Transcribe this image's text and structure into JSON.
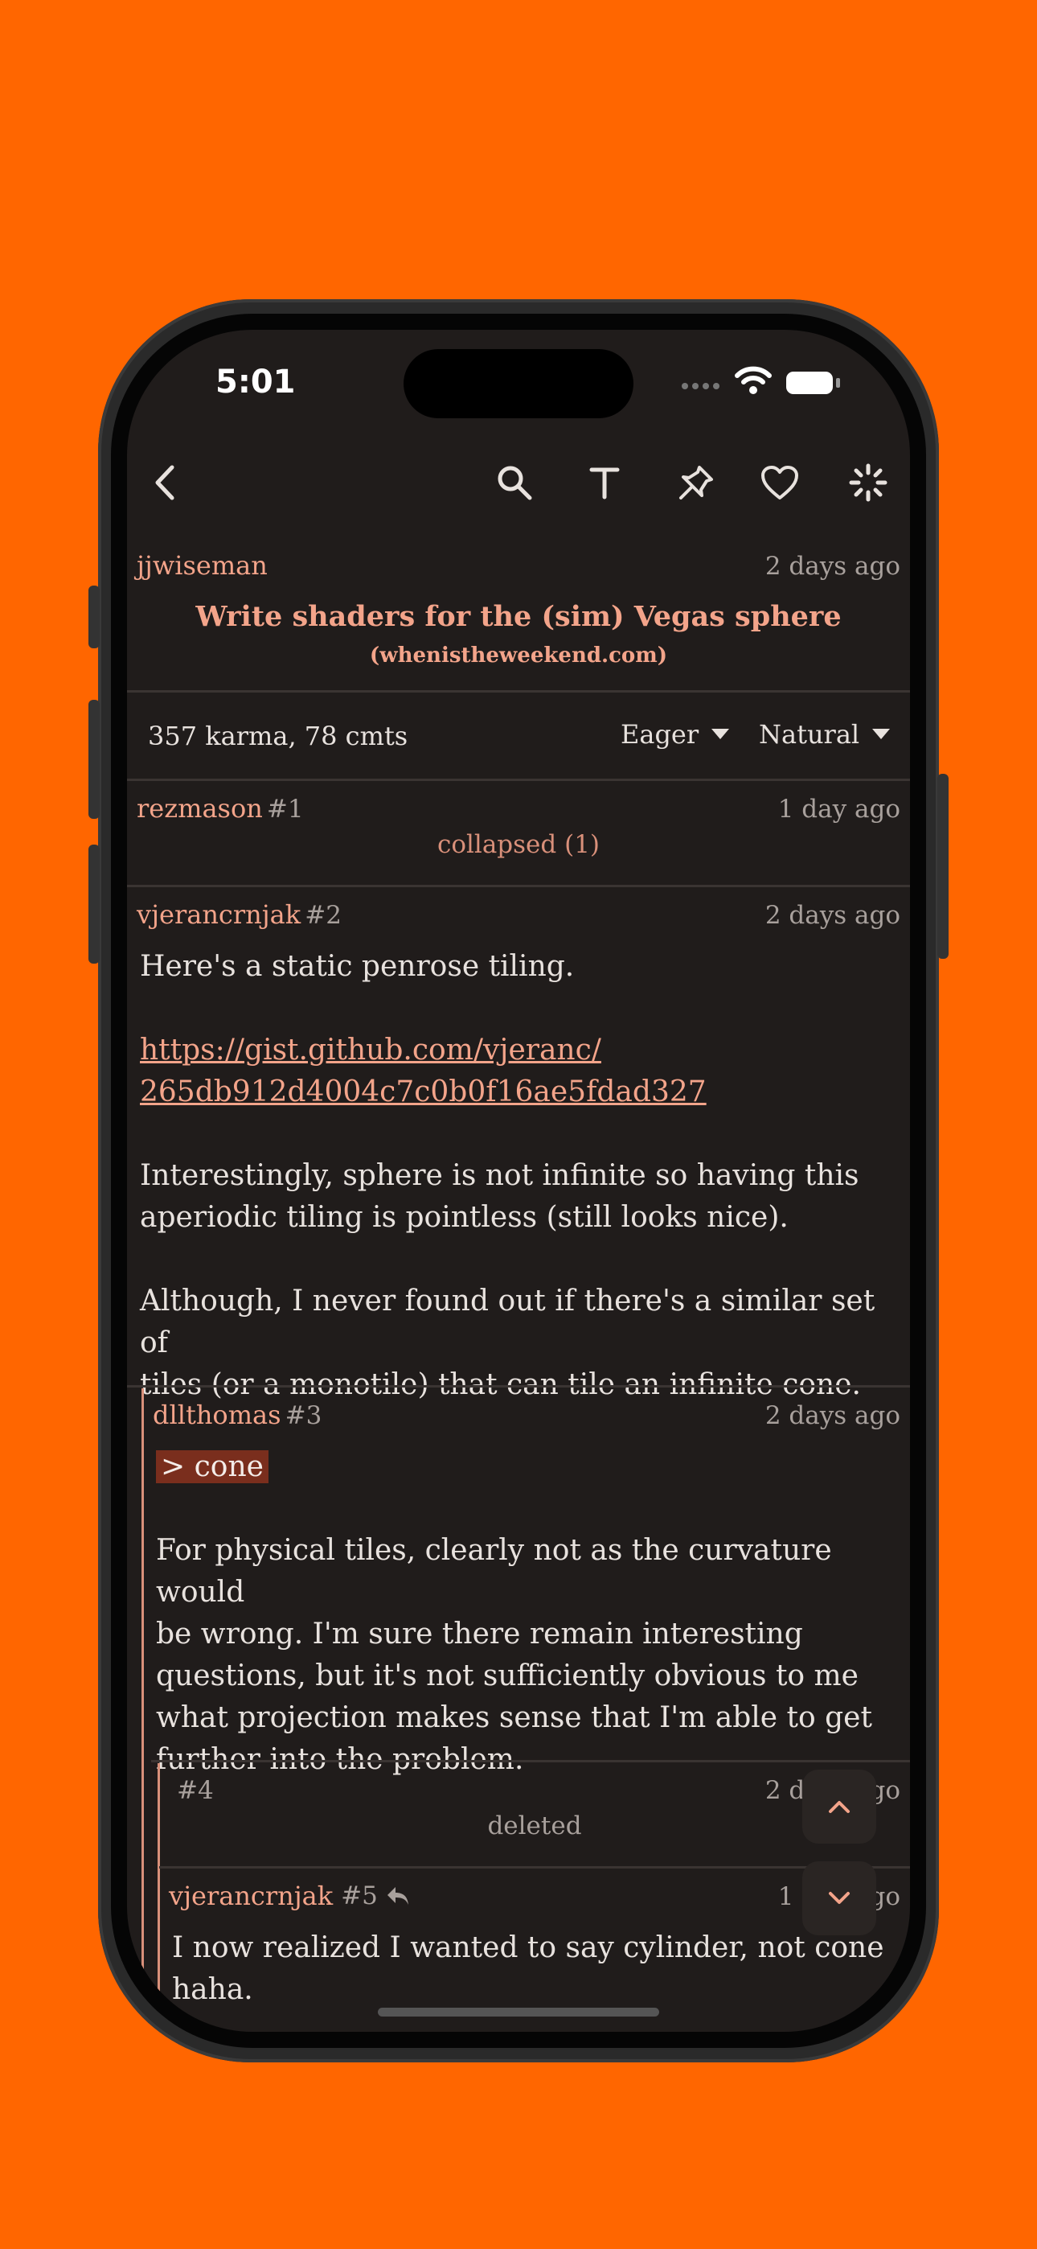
{
  "status_bar": {
    "time": "5:01"
  },
  "toolbar": {
    "back_icon": "chevron-left-icon",
    "icons": [
      "search-icon",
      "text-size-icon",
      "pin-icon",
      "heart-icon",
      "loading-spinner-icon"
    ]
  },
  "story": {
    "author": "jjwiseman",
    "age": "2 days ago",
    "title": "Write shaders for the (sim) Vegas sphere",
    "domain": "(whenistheweekend.com)"
  },
  "stats": {
    "summary": "357 karma, 78 cmts",
    "load_mode": "Eager",
    "sort_mode": "Natural"
  },
  "comments": [
    {
      "author": "rezmason",
      "index": "#1",
      "age": "1 day ago",
      "collapsed_label": "collapsed (1)"
    },
    {
      "author": "vjerancrnjak",
      "index": "#2",
      "age": "2 days ago",
      "p1": "Here's a static penrose tiling.",
      "link_line1": "https://gist.github.com/vjeranc/",
      "link_line2": "265db912d4004c7c0b0f16ae5fdad327",
      "p2_line1": "Interestingly, sphere is not infinite so having this",
      "p2_line2": "aperiodic tiling is pointless (still looks nice).",
      "p3_line1": "Although, I never found out if there's a similar set of",
      "p3_line2": "tiles (or a monotile) that can tile an infinite cone."
    },
    {
      "author": "dllthomas",
      "index": "#3",
      "age": "2 days ago",
      "quote": "> cone",
      "l1": "For physical tiles, clearly not as the curvature would",
      "l2": "be wrong.  I'm sure there remain interesting",
      "l3": "questions, but it's not sufficiently obvious to me",
      "l4": "what projection makes sense that I'm able to get",
      "l5": "further into the problem."
    },
    {
      "author": "",
      "index": "#4",
      "age": "2 days ago",
      "deleted_label": "deleted"
    },
    {
      "author": "vjerancrnjak",
      "index": "#5",
      "age": "1 day ago",
      "l1": "I now realized I wanted to say cylinder, not cone",
      "l2": "haha."
    }
  ],
  "nav": {
    "up_icon": "chevron-up-icon",
    "down_icon": "chevron-down-icon"
  },
  "colors": {
    "background": "#ff6600",
    "screen": "#201c1b",
    "accent": "#f3a48a"
  }
}
